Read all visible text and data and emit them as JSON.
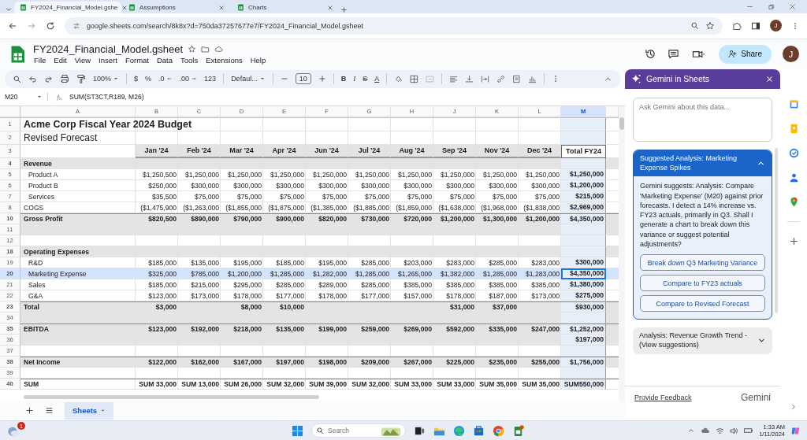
{
  "browser": {
    "tabs": [
      {
        "title": "FY2024_Financial_Model.gshe",
        "selected": true
      },
      {
        "title": "Assumptions",
        "selected": false
      },
      {
        "title": "Charts",
        "selected": false
      }
    ],
    "url": "google.sheets.com/search/8k8x?d=750da37257677e7/FY2024_Financial_Model.gsheet",
    "profile_initial": "J"
  },
  "document": {
    "title": "FY2024_Financial_Model.gsheet",
    "menu": [
      "File",
      "Edit",
      "View",
      "Insert",
      "Format",
      "Data",
      "Tools",
      "Extensions",
      "Help"
    ],
    "share_label": "Share",
    "account_initial": "J"
  },
  "toolbar": {
    "zoom": "100%",
    "currency": "$",
    "percent": "%",
    "decrease_decimals": ".0",
    "increase_decimals": ".00",
    "number_format": "123",
    "font": "Defaul...",
    "font_size": "10",
    "bold": "B",
    "italic": "I",
    "strikethrough": "S",
    "text_color": "A"
  },
  "formula_bar": {
    "cell": "M20",
    "formula": "SUM(ST3CT,R189, M26)"
  },
  "columns": [
    {
      "letter": "A",
      "selected": false
    },
    {
      "letter": "B",
      "selected": false
    },
    {
      "letter": "C",
      "selected": false
    },
    {
      "letter": "D",
      "selected": false
    },
    {
      "letter": "E",
      "selected": false
    },
    {
      "letter": "F",
      "selected": false
    },
    {
      "letter": "G",
      "selected": false
    },
    {
      "letter": "H",
      "selected": false
    },
    {
      "letter": "J",
      "selected": false
    },
    {
      "letter": "K",
      "selected": false
    },
    {
      "letter": "L",
      "selected": false
    },
    {
      "letter": "M",
      "selected": true
    }
  ],
  "rows": [
    {
      "number": "1",
      "kind": "title",
      "label": "Acme Corp Fiscal Year 2024 Budget",
      "shaded": false,
      "selected": false
    },
    {
      "number": "2",
      "kind": "subtitle",
      "label": "Revised Forecast",
      "shaded": false,
      "selected": false
    },
    {
      "number": "3",
      "kind": "header",
      "values": [
        "Jan '24",
        "Feb '24",
        "Mar '24",
        "Apr '24",
        "Jun '24",
        "Jul '24",
        "Aug '24",
        "Sep '24",
        "Nov '24",
        "Dec '24"
      ],
      "total": "Total FY24",
      "shaded": false,
      "selected": false
    },
    {
      "number": "4",
      "kind": "section",
      "label": "Revenue",
      "shaded": true,
      "selected": false
    },
    {
      "number": "5",
      "kind": "item",
      "label": "Product A",
      "values": [
        "$1,250,500",
        "$1,250,000",
        "$1,250,000",
        "$1,250,000",
        "$1,250,000",
        "$1,250,000",
        "$1,250,000",
        "$1,250,000",
        "$1,250,000",
        "$1,250,000"
      ],
      "total": "$1,250,000",
      "shaded": false,
      "selected": false
    },
    {
      "number": "6",
      "kind": "item",
      "label": "Product B",
      "values": [
        "$250,000",
        "$300,000",
        "$300,000",
        "$300,000",
        "$300,000",
        "$300,000",
        "$300,000",
        "$300,000",
        "$300,000",
        "$300,000"
      ],
      "total": "$1,200,000",
      "shaded": false,
      "selected": false
    },
    {
      "number": "7",
      "kind": "item",
      "label": "Services",
      "values": [
        "$35,500",
        "$75,000",
        "$75,000",
        "$75,000",
        "$75,000",
        "$75,000",
        "$75,000",
        "$75,000",
        "$75,000",
        "$75,000"
      ],
      "total": "$215,000",
      "shaded": false,
      "selected": false
    },
    {
      "number": "8",
      "kind": "plain",
      "label": "COGS",
      "values": [
        "($1,475,900",
        "($1,263,000",
        "($1,855,000",
        "($1,875,000",
        "($1,385,000",
        "($1,885,000",
        "($1,859,000",
        "($1,638,000",
        "($1,968,000",
        "($1,838,000"
      ],
      "total": "$2,969,000",
      "shaded": false,
      "selected": false
    },
    {
      "number": "10",
      "kind": "total",
      "label": "Gross Profit",
      "values": [
        "$820,500",
        "$890,000",
        "$790,000",
        "$900,000",
        "$820,000",
        "$730,000",
        "$720,000",
        "$1,200,000",
        "$1,300,000",
        "$1,200,000"
      ],
      "total": "$4,350,000",
      "shaded": true,
      "selected": false
    },
    {
      "number": "11",
      "kind": "blank",
      "shaded": true,
      "selected": false
    },
    {
      "number": "12",
      "kind": "blank",
      "shaded": false,
      "selected": false
    },
    {
      "number": "18",
      "kind": "section",
      "label": "Operating Expenses",
      "shaded": true,
      "selected": false
    },
    {
      "number": "19",
      "kind": "item",
      "label": "R&D",
      "values": [
        "$185,000",
        "$135,000",
        "$195,000",
        "$185,000",
        "$195,000",
        "$285,000",
        "$203,000",
        "$283,000",
        "$285,000",
        "$283,000"
      ],
      "total": "$300,000",
      "shaded": false,
      "selected": false
    },
    {
      "number": "20",
      "kind": "item",
      "label": "Marketing Expense",
      "values": [
        "$325,000",
        "$785,000",
        "$1,200,000",
        "$1,285,000",
        "$1,282,000",
        "$1,285,000",
        "$1,265,000",
        "$1,382,000",
        "$1,285,000",
        "$1,283,000"
      ],
      "total": "$4,350,000",
      "shaded": false,
      "selected": true
    },
    {
      "number": "21",
      "kind": "item",
      "label": "Sales",
      "values": [
        "$185,000",
        "$215,000",
        "$295,000",
        "$285,000",
        "$289,000",
        "$285,000",
        "$385,000",
        "$385,000",
        "$385,000",
        "$385,000"
      ],
      "total": "$1,380,000",
      "shaded": false,
      "selected": false
    },
    {
      "number": "22",
      "kind": "item",
      "label": "G&A",
      "values": [
        "$123,000",
        "$173,000",
        "$178,000",
        "$177,000",
        "$178,000",
        "$177,000",
        "$157,000",
        "$178,000",
        "$187,000",
        "$173,000"
      ],
      "total": "$275,000",
      "shaded": false,
      "selected": false
    },
    {
      "number": "23",
      "kind": "total",
      "label": "Total",
      "values_by_column": {
        "B": "$3,000",
        "D": "$8,000",
        "E": "$10,000",
        "J": "$31,000",
        "K": "$37,000"
      },
      "total": "$930,000",
      "shaded": true,
      "selected": false
    },
    {
      "number": "34",
      "kind": "blank",
      "shaded": true,
      "selected": false
    },
    {
      "number": "35",
      "kind": "total",
      "label": "EBITDA",
      "values": [
        "$123,000",
        "$192,000",
        "$218,000",
        "$135,000",
        "$199,000",
        "$259,000",
        "$269,000",
        "$592,000",
        "$335,000",
        "$247,000"
      ],
      "total": "$1,252,000",
      "shaded": true,
      "selected": false
    },
    {
      "number": "36",
      "kind": "blank",
      "total": "$197,000",
      "shaded": true,
      "selected": false
    },
    {
      "number": "37",
      "kind": "blank",
      "shaded": false,
      "selected": false
    },
    {
      "number": "38",
      "kind": "total",
      "label": "Net Income",
      "values": [
        "$122,000",
        "$162,000",
        "$167,000",
        "$197,000",
        "$198,000",
        "$209,000",
        "$267,000",
        "$225,000",
        "$235,000",
        "$255,000"
      ],
      "total": "$1,756,000",
      "shaded": true,
      "selected": false
    },
    {
      "number": "39",
      "kind": "blank",
      "shaded": false,
      "selected": false
    },
    {
      "number": "40",
      "kind": "total",
      "label": "SUM",
      "values": [
        "SUM 33,000",
        "SUM 13,000",
        "SUM 26,000",
        "SUM 32,000",
        "SUM 39,000",
        "SUM 32,000",
        "SUM 33,000",
        "SUM 33,000",
        "SUM 35,000",
        "SUM 35,000"
      ],
      "total": "SUM550,000",
      "shaded": false,
      "selected": false
    }
  ],
  "sheet_tabs": [
    {
      "label": "Sheets",
      "selected": true
    }
  ],
  "gemini": {
    "title": "Gemini in Sheets",
    "prompt_placeholder": "Ask Gemini about this data...",
    "cards": [
      {
        "title": "Suggested Analysis: Marketing Expense Spikes",
        "expanded": true,
        "body": "Gemini suggests: Analysis: Compare 'Marketing Expense' (M20) against prior forecasts. I detect a 14% increase vs. FY23 actuals, primarily in Q3. Shall I generate a chart to break down this variance or suggest potential adjustments?",
        "actions": [
          "Break down Q3 Marketing Variance",
          "Compare to FY23 actuals",
          "Compare to Revised Forecast"
        ]
      },
      {
        "title": "Analysis: Revenue Growth Trend - (View suggestions)",
        "expanded": false
      }
    ],
    "feedback_link": "Provide Feedback",
    "brand": "Gemini"
  },
  "taskbar": {
    "notification_count": "1",
    "search_placeholder": "Search",
    "time": "1:33 AM",
    "date": "1/11/2024"
  }
}
